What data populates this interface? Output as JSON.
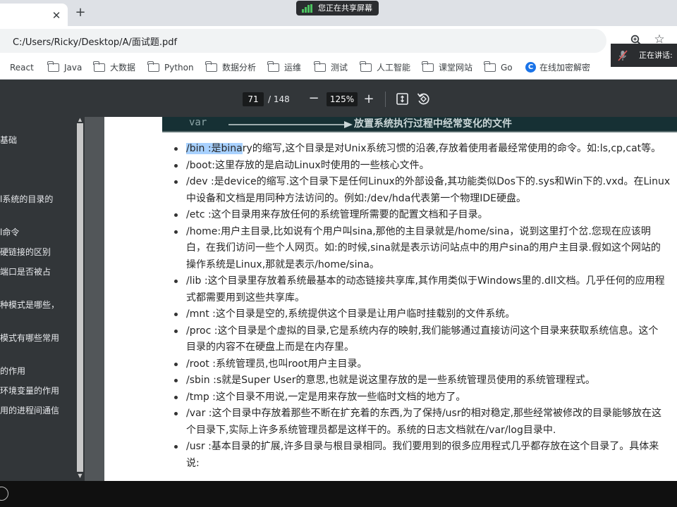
{
  "browser": {
    "new_tab_label": "+",
    "close_glyph": "✕",
    "address": "C:/Users/Ricky/Desktop/A/面试题.pdf",
    "bookmarks": [
      {
        "label": "React",
        "icon": "react-icon"
      },
      {
        "label": "Java",
        "icon": "folder-icon"
      },
      {
        "label": "大数据",
        "icon": "folder-icon"
      },
      {
        "label": "Python",
        "icon": "folder-icon"
      },
      {
        "label": "数据分析",
        "icon": "folder-icon"
      },
      {
        "label": "运维",
        "icon": "folder-icon"
      },
      {
        "label": "测试",
        "icon": "folder-icon"
      },
      {
        "label": "人工智能",
        "icon": "folder-icon"
      },
      {
        "label": "课堂网站",
        "icon": "folder-icon"
      },
      {
        "label": "Go",
        "icon": "folder-icon"
      },
      {
        "label": "在线加密解密",
        "icon": "c-logo-icon"
      }
    ]
  },
  "screen_share": {
    "label": "您正在共享屏幕",
    "speaking_label": "正在讲话:"
  },
  "pdf_toolbar": {
    "page_current": "71",
    "page_total": "/ 148",
    "zoom": "125%",
    "zoom_out_glyph": "−",
    "zoom_in_glyph": "+"
  },
  "outline": [
    "基础",
    "l系统的目录的",
    "l命令",
    "硬链接的区别",
    "端口是否被占",
    "种模式是哪些，",
    "模式有哪些常用",
    "的作用",
    "环境变量的作用",
    "用的进程间通信"
  ],
  "document": {
    "banner_var": "var",
    "banner_text": "放置系统执行过程中经常变化的文件",
    "first_item_highlight": "/bin :是bina",
    "first_item_rest": "ry的缩写,这个目录是对Unix系统习惯的沿袭,存放着使用者最经常使用的命令。如:ls,cp,cat等。",
    "items": [
      "/boot:这里存放的是启动Linux时使用的一些核心文件。",
      "/dev :是device的缩写.这个目录下是任何Linux的外部设备,其功能类似Dos下的.sys和Win下的.vxd。在Linux\n中设备和文档是用同种方法访问的。例如:/dev/hda代表第一个物理IDE硬盘。",
      "/etc :这个目录用来存放任何的系统管理所需要的配置文档和子目录。",
      "/home:用户主目录,比如说有个用户叫sina,那他的主目录就是/home/sina，说到这里打个岔.您现在应该明\n白，在我们访问一些个人网页。如:的时候,sina就是表示访问站点中的用户sina的用户主目录.假如这个网站的\n操作系统是Linux,那就是表示/home/sina。",
      "/lib :这个目录里存放着系统最基本的动态链接共享库,其作用类似于Windows里的.dll文档。几乎任何的应用程\n式都需要用到这些共享库。",
      "/mnt :这个目录是空的,系统提供这个目录是让用户临时挂载别的文件系统。",
      "/proc :这个目录是个虚拟的目录,它是系统内存的映射,我们能够通过直接访问这个目录来获取系统信息。这个\n目录的内容不在硬盘上而是在内存里。",
      "/root :系统管理员,也叫root用户主目录。",
      "/sbin :s就是Super User的意思,也就是说这里存放的是一些系统管理员使用的系统管理程式。",
      "/tmp :这个目录不用说,一定是用来存放一些临时文档的地方了。",
      "/var :这个目录中存放着那些不断在扩充着的东西,为了保持/usr的相对稳定,那些经常被修改的目录能够放在这\n个目录下,实际上许多系统管理员都是这样干的。系统的日志文档就在/var/log目录中.",
      "/usr :基本目录的扩展,许多目录与根目录相同。我们要用到的很多应用程式几乎都存放在这个目录了。具体来\n说:"
    ]
  },
  "colors": {
    "chrome_bg": "#dee1e6",
    "pdf_toolbar": "#323639",
    "pdf_canvas": "#525659",
    "highlight": "#a8d1ff",
    "banner_bg": "#163034"
  }
}
